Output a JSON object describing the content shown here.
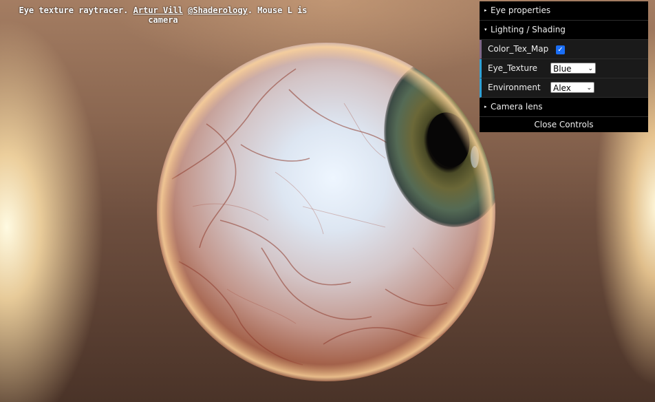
{
  "caption": {
    "text_prefix": "Eye texture raytracer. ",
    "author_link": "Artur Vill",
    "separator": " ",
    "twitter_link": "@Shaderology",
    "text_suffix": ". Mouse L is camera"
  },
  "gui": {
    "folders": {
      "eye_properties": "Eye properties",
      "lighting_shading": "Lighting / Shading",
      "camera_lens": "Camera lens"
    },
    "controls": {
      "color_tex_map": {
        "label": "Color_Tex_Map",
        "checked": true,
        "check_glyph": "✓"
      },
      "eye_texture": {
        "label": "Eye_Texture",
        "value": "Blue"
      },
      "environment": {
        "label": "Environment",
        "value": "Alex"
      }
    },
    "close_label": "Close Controls",
    "collapsed_glyph": "▸",
    "expanded_glyph": "▾",
    "dropdown_glyph": "⌄"
  }
}
